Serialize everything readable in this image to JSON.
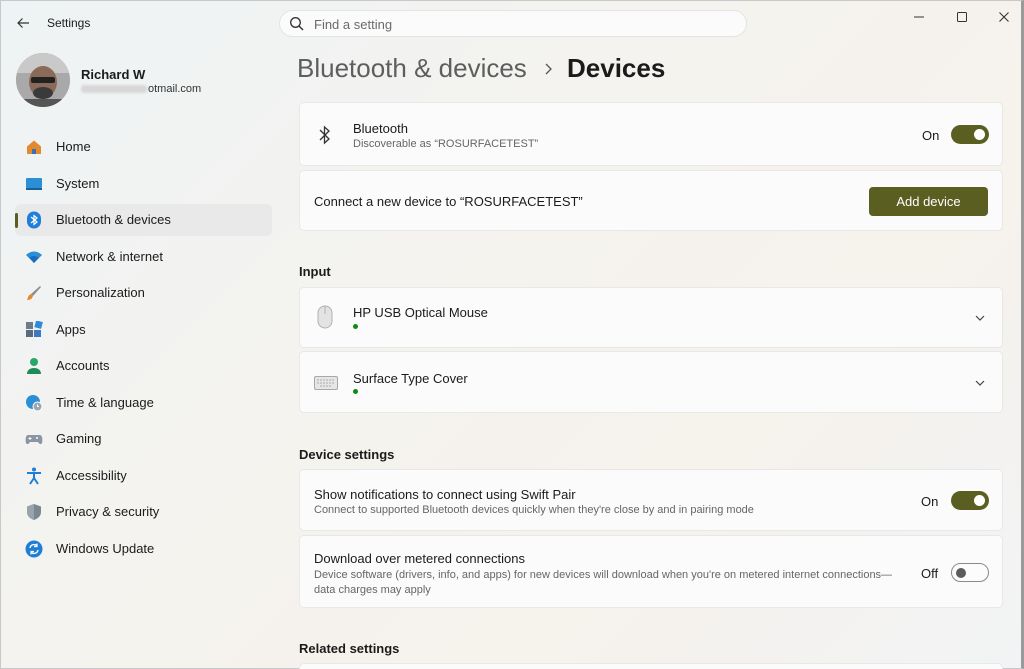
{
  "window": {
    "app_title": "Settings",
    "search_placeholder": "Find a setting"
  },
  "profile": {
    "name": "Richard W",
    "email_visible": "otmail.com"
  },
  "sidebar": {
    "items": [
      {
        "label": "Home",
        "icon": "home-icon"
      },
      {
        "label": "System",
        "icon": "system-icon"
      },
      {
        "label": "Bluetooth & devices",
        "icon": "bluetooth-icon",
        "active": true
      },
      {
        "label": "Network & internet",
        "icon": "wifi-icon"
      },
      {
        "label": "Personalization",
        "icon": "brush-icon"
      },
      {
        "label": "Apps",
        "icon": "apps-icon"
      },
      {
        "label": "Accounts",
        "icon": "person-icon"
      },
      {
        "label": "Time & language",
        "icon": "globe-clock-icon"
      },
      {
        "label": "Gaming",
        "icon": "gamepad-icon"
      },
      {
        "label": "Accessibility",
        "icon": "accessibility-icon"
      },
      {
        "label": "Privacy & security",
        "icon": "shield-icon"
      },
      {
        "label": "Windows Update",
        "icon": "update-icon"
      }
    ]
  },
  "breadcrumb": {
    "parent": "Bluetooth & devices",
    "current": "Devices"
  },
  "bluetooth_card": {
    "title": "Bluetooth",
    "subtitle": "Discoverable as “ROSURFACETEST”",
    "state": "On"
  },
  "connect_card": {
    "text": "Connect a new device to “ROSURFACETEST”",
    "button": "Add device"
  },
  "input_section": {
    "title": "Input",
    "devices": [
      {
        "name": "HP USB Optical Mouse",
        "icon": "mouse-icon"
      },
      {
        "name": "Surface Type Cover",
        "icon": "keyboard-icon"
      }
    ]
  },
  "device_settings": {
    "title": "Device settings",
    "swift_pair": {
      "title": "Show notifications to connect using Swift Pair",
      "subtitle": "Connect to supported Bluetooth devices quickly when they're close by and in pairing mode",
      "state": "On"
    },
    "metered": {
      "title": "Download over metered connections",
      "subtitle_line1": "Device software (drivers, info, and apps) for new devices will download when you're on metered internet connections—",
      "subtitle_line2": "data charges may apply",
      "state": "Off"
    }
  },
  "related_settings": {
    "title": "Related settings"
  },
  "colors": {
    "accent": "#5a5e20",
    "status_dot": "#128a12"
  }
}
